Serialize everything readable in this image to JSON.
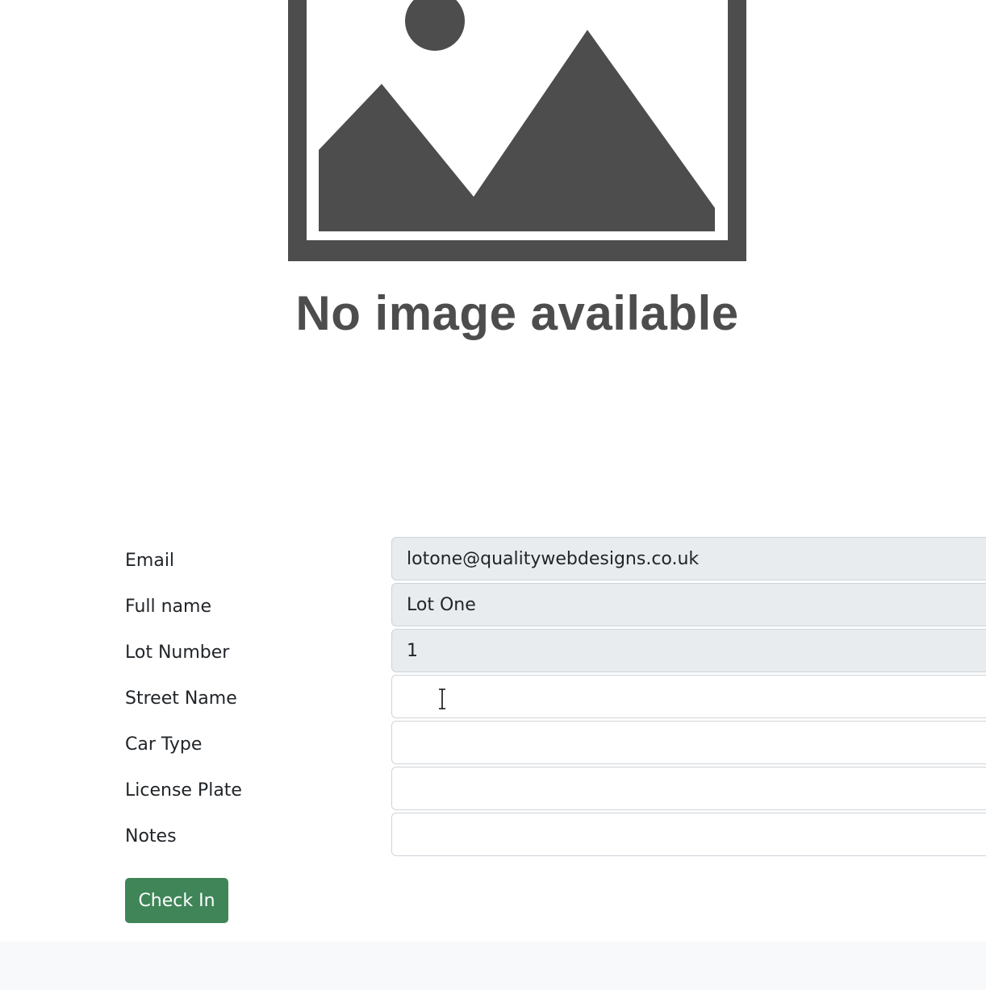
{
  "placeholder": {
    "caption": "No image available",
    "icon": "image-placeholder-icon"
  },
  "form": {
    "fields": [
      {
        "label": "Email",
        "value": "lotone@qualitywebdesigns.co.uk",
        "readonly": true
      },
      {
        "label": "Full name",
        "value": "Lot One",
        "readonly": true
      },
      {
        "label": "Lot Number",
        "value": "1",
        "readonly": true
      },
      {
        "label": "Street Name",
        "value": "",
        "readonly": false
      },
      {
        "label": "Car Type",
        "value": "",
        "readonly": false
      },
      {
        "label": "License Plate",
        "value": "",
        "readonly": false
      },
      {
        "label": "Notes",
        "value": "",
        "readonly": false
      }
    ],
    "submit_label": "Check In"
  },
  "colors": {
    "button": "#3f8558",
    "readonly_field": "#e9ecef",
    "placeholder_gray": "#4d4d4d",
    "footer": "#f8f9fa"
  }
}
